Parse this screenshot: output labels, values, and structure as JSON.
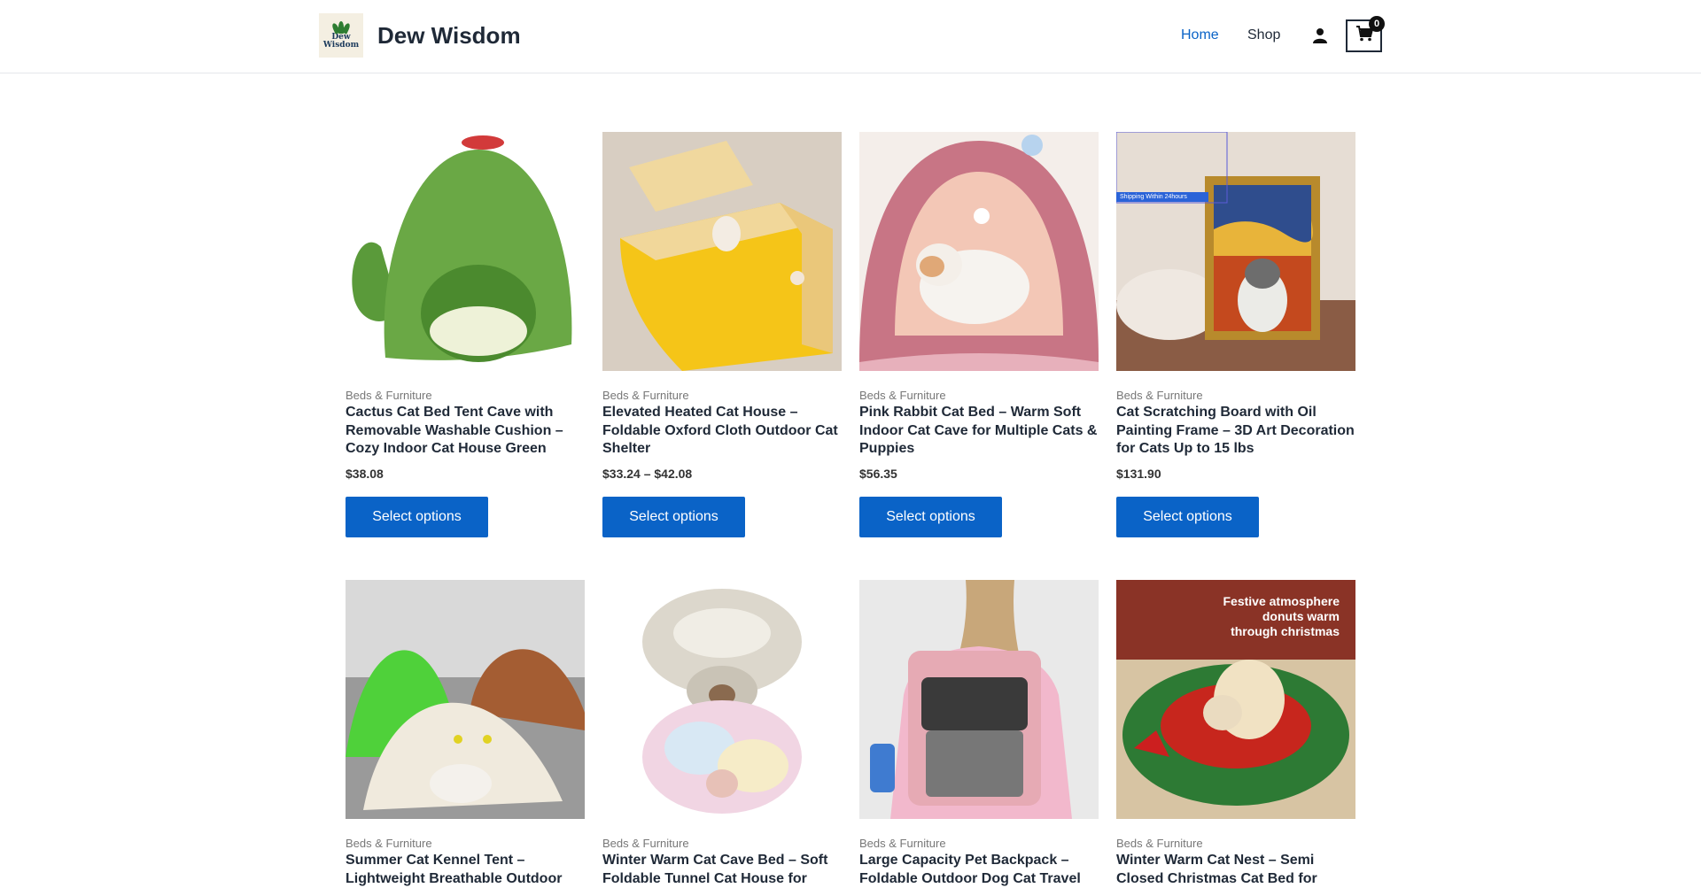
{
  "header": {
    "brand": "Dew Wisdom",
    "logo_text_1": "Dew",
    "logo_text_2": "Wisdom",
    "nav": [
      {
        "label": "Home",
        "active": true
      },
      {
        "label": "Shop",
        "active": false
      }
    ],
    "user_icon": "user-icon",
    "cart_icon": "shopping-cart-icon",
    "cart_count": "0",
    "accent_color": "#0a63c7"
  },
  "products": [
    {
      "category": "Beds & Furniture",
      "title": "Cactus Cat Bed Tent Cave with Removable Washable Cushion – Cozy Indoor Cat House Green",
      "price": "$38.08",
      "button": "Select options"
    },
    {
      "category": "Beds & Furniture",
      "title": "Elevated Heated Cat House – Foldable Oxford Cloth Outdoor Cat Shelter",
      "price": "$33.24 – $42.08",
      "button": "Select options"
    },
    {
      "category": "Beds & Furniture",
      "title": "Pink Rabbit Cat Bed – Warm Soft Indoor Cat Cave for Multiple Cats & Puppies",
      "price": "$56.35",
      "button": "Select options"
    },
    {
      "category": "Beds & Furniture",
      "title": "Cat Scratching Board with Oil Painting Frame – 3D Art Decoration for Cats Up to 15 lbs",
      "price": "$131.90",
      "button": "Select options",
      "image_tag": "Shipping Within 24hours"
    },
    {
      "category": "Beds & Furniture",
      "title": "Summer Cat Kennel Tent – Lightweight Breathable Outdoor"
    },
    {
      "category": "Beds & Furniture",
      "title": "Winter Warm Cat Cave Bed – Soft Foldable Tunnel Cat House for"
    },
    {
      "category": "Beds & Furniture",
      "title": "Large Capacity Pet Backpack – Foldable Outdoor Dog Cat Travel"
    },
    {
      "category": "Beds & Furniture",
      "title": "Winter Warm Cat Nest – Semi Closed Christmas Cat Bed for",
      "image_overlay": [
        "Festive atmosphere",
        "donuts warm",
        "through christmas"
      ]
    }
  ]
}
